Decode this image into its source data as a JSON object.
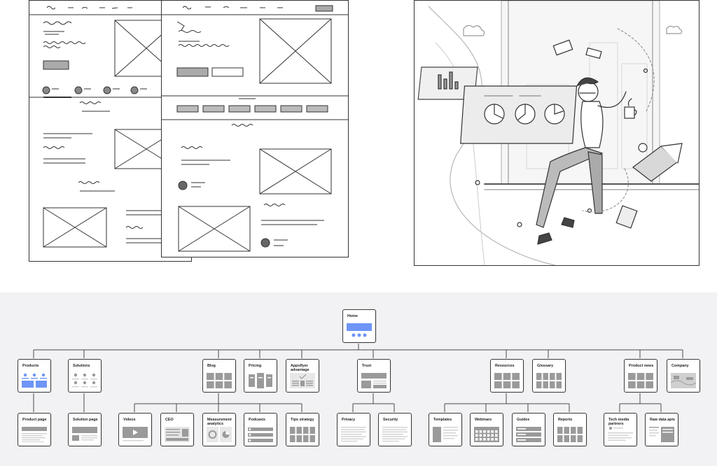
{
  "sitemap": {
    "colors": {
      "accent": "#6e95f7",
      "box": "#9a9a9a",
      "light": "#d0d0d0",
      "line": "#4a4a4a",
      "bg": "#f2f2f4"
    },
    "home": {
      "label": "Home",
      "art": "home"
    },
    "level1": [
      {
        "label": "Products",
        "art": "products"
      },
      {
        "label": "Solutions",
        "art": "people"
      },
      {
        "label": "Blog",
        "art": "grid6"
      },
      {
        "label": "Pricing",
        "art": "pricing"
      },
      {
        "label": "Appsflyer advantage",
        "art": "advantage"
      },
      {
        "label": "Trust",
        "art": "trust"
      },
      {
        "label": "Resources",
        "art": "grid6"
      },
      {
        "label": "Glossary",
        "art": "grid8"
      },
      {
        "label": "Product news",
        "art": "grid6"
      },
      {
        "label": "Company",
        "art": "company"
      }
    ],
    "level2": [
      {
        "label": "Product page",
        "art": "page"
      },
      {
        "label": "Solution page",
        "art": "solution"
      },
      {
        "label": "Videos",
        "art": "video"
      },
      {
        "label": "CEO",
        "art": "ceo"
      },
      {
        "label": "Measurement analytics",
        "art": "analytics"
      },
      {
        "label": "Podcasts",
        "art": "podcasts"
      },
      {
        "label": "Tips strategy",
        "art": "grid8"
      },
      {
        "label": "Privacy",
        "art": "text"
      },
      {
        "label": "Security",
        "art": "text"
      },
      {
        "label": "Templates",
        "art": "templates"
      },
      {
        "label": "Webinars",
        "art": "calendar"
      },
      {
        "label": "Guides",
        "art": "guides"
      },
      {
        "label": "Reports",
        "art": "grid8"
      },
      {
        "label": "Tech media partners",
        "art": "techmedia"
      },
      {
        "label": "Raw data apis",
        "art": "rawdata"
      }
    ]
  }
}
